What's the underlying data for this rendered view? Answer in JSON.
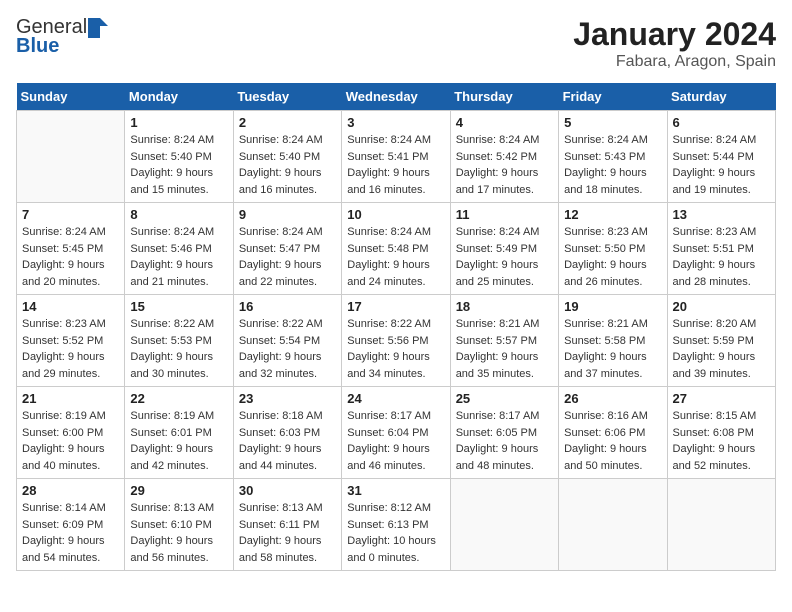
{
  "header": {
    "logo_general": "General",
    "logo_blue": "Blue",
    "title": "January 2024",
    "subtitle": "Fabara, Aragon, Spain"
  },
  "weekdays": [
    "Sunday",
    "Monday",
    "Tuesday",
    "Wednesday",
    "Thursday",
    "Friday",
    "Saturday"
  ],
  "weeks": [
    [
      {
        "day": "",
        "info": []
      },
      {
        "day": "1",
        "info": [
          "Sunrise: 8:24 AM",
          "Sunset: 5:40 PM",
          "Daylight: 9 hours",
          "and 15 minutes."
        ]
      },
      {
        "day": "2",
        "info": [
          "Sunrise: 8:24 AM",
          "Sunset: 5:40 PM",
          "Daylight: 9 hours",
          "and 16 minutes."
        ]
      },
      {
        "day": "3",
        "info": [
          "Sunrise: 8:24 AM",
          "Sunset: 5:41 PM",
          "Daylight: 9 hours",
          "and 16 minutes."
        ]
      },
      {
        "day": "4",
        "info": [
          "Sunrise: 8:24 AM",
          "Sunset: 5:42 PM",
          "Daylight: 9 hours",
          "and 17 minutes."
        ]
      },
      {
        "day": "5",
        "info": [
          "Sunrise: 8:24 AM",
          "Sunset: 5:43 PM",
          "Daylight: 9 hours",
          "and 18 minutes."
        ]
      },
      {
        "day": "6",
        "info": [
          "Sunrise: 8:24 AM",
          "Sunset: 5:44 PM",
          "Daylight: 9 hours",
          "and 19 minutes."
        ]
      }
    ],
    [
      {
        "day": "7",
        "info": [
          "Sunrise: 8:24 AM",
          "Sunset: 5:45 PM",
          "Daylight: 9 hours",
          "and 20 minutes."
        ]
      },
      {
        "day": "8",
        "info": [
          "Sunrise: 8:24 AM",
          "Sunset: 5:46 PM",
          "Daylight: 9 hours",
          "and 21 minutes."
        ]
      },
      {
        "day": "9",
        "info": [
          "Sunrise: 8:24 AM",
          "Sunset: 5:47 PM",
          "Daylight: 9 hours",
          "and 22 minutes."
        ]
      },
      {
        "day": "10",
        "info": [
          "Sunrise: 8:24 AM",
          "Sunset: 5:48 PM",
          "Daylight: 9 hours",
          "and 24 minutes."
        ]
      },
      {
        "day": "11",
        "info": [
          "Sunrise: 8:24 AM",
          "Sunset: 5:49 PM",
          "Daylight: 9 hours",
          "and 25 minutes."
        ]
      },
      {
        "day": "12",
        "info": [
          "Sunrise: 8:23 AM",
          "Sunset: 5:50 PM",
          "Daylight: 9 hours",
          "and 26 minutes."
        ]
      },
      {
        "day": "13",
        "info": [
          "Sunrise: 8:23 AM",
          "Sunset: 5:51 PM",
          "Daylight: 9 hours",
          "and 28 minutes."
        ]
      }
    ],
    [
      {
        "day": "14",
        "info": [
          "Sunrise: 8:23 AM",
          "Sunset: 5:52 PM",
          "Daylight: 9 hours",
          "and 29 minutes."
        ]
      },
      {
        "day": "15",
        "info": [
          "Sunrise: 8:22 AM",
          "Sunset: 5:53 PM",
          "Daylight: 9 hours",
          "and 30 minutes."
        ]
      },
      {
        "day": "16",
        "info": [
          "Sunrise: 8:22 AM",
          "Sunset: 5:54 PM",
          "Daylight: 9 hours",
          "and 32 minutes."
        ]
      },
      {
        "day": "17",
        "info": [
          "Sunrise: 8:22 AM",
          "Sunset: 5:56 PM",
          "Daylight: 9 hours",
          "and 34 minutes."
        ]
      },
      {
        "day": "18",
        "info": [
          "Sunrise: 8:21 AM",
          "Sunset: 5:57 PM",
          "Daylight: 9 hours",
          "and 35 minutes."
        ]
      },
      {
        "day": "19",
        "info": [
          "Sunrise: 8:21 AM",
          "Sunset: 5:58 PM",
          "Daylight: 9 hours",
          "and 37 minutes."
        ]
      },
      {
        "day": "20",
        "info": [
          "Sunrise: 8:20 AM",
          "Sunset: 5:59 PM",
          "Daylight: 9 hours",
          "and 39 minutes."
        ]
      }
    ],
    [
      {
        "day": "21",
        "info": [
          "Sunrise: 8:19 AM",
          "Sunset: 6:00 PM",
          "Daylight: 9 hours",
          "and 40 minutes."
        ]
      },
      {
        "day": "22",
        "info": [
          "Sunrise: 8:19 AM",
          "Sunset: 6:01 PM",
          "Daylight: 9 hours",
          "and 42 minutes."
        ]
      },
      {
        "day": "23",
        "info": [
          "Sunrise: 8:18 AM",
          "Sunset: 6:03 PM",
          "Daylight: 9 hours",
          "and 44 minutes."
        ]
      },
      {
        "day": "24",
        "info": [
          "Sunrise: 8:17 AM",
          "Sunset: 6:04 PM",
          "Daylight: 9 hours",
          "and 46 minutes."
        ]
      },
      {
        "day": "25",
        "info": [
          "Sunrise: 8:17 AM",
          "Sunset: 6:05 PM",
          "Daylight: 9 hours",
          "and 48 minutes."
        ]
      },
      {
        "day": "26",
        "info": [
          "Sunrise: 8:16 AM",
          "Sunset: 6:06 PM",
          "Daylight: 9 hours",
          "and 50 minutes."
        ]
      },
      {
        "day": "27",
        "info": [
          "Sunrise: 8:15 AM",
          "Sunset: 6:08 PM",
          "Daylight: 9 hours",
          "and 52 minutes."
        ]
      }
    ],
    [
      {
        "day": "28",
        "info": [
          "Sunrise: 8:14 AM",
          "Sunset: 6:09 PM",
          "Daylight: 9 hours",
          "and 54 minutes."
        ]
      },
      {
        "day": "29",
        "info": [
          "Sunrise: 8:13 AM",
          "Sunset: 6:10 PM",
          "Daylight: 9 hours",
          "and 56 minutes."
        ]
      },
      {
        "day": "30",
        "info": [
          "Sunrise: 8:13 AM",
          "Sunset: 6:11 PM",
          "Daylight: 9 hours",
          "and 58 minutes."
        ]
      },
      {
        "day": "31",
        "info": [
          "Sunrise: 8:12 AM",
          "Sunset: 6:13 PM",
          "Daylight: 10 hours",
          "and 0 minutes."
        ]
      },
      {
        "day": "",
        "info": []
      },
      {
        "day": "",
        "info": []
      },
      {
        "day": "",
        "info": []
      }
    ]
  ]
}
